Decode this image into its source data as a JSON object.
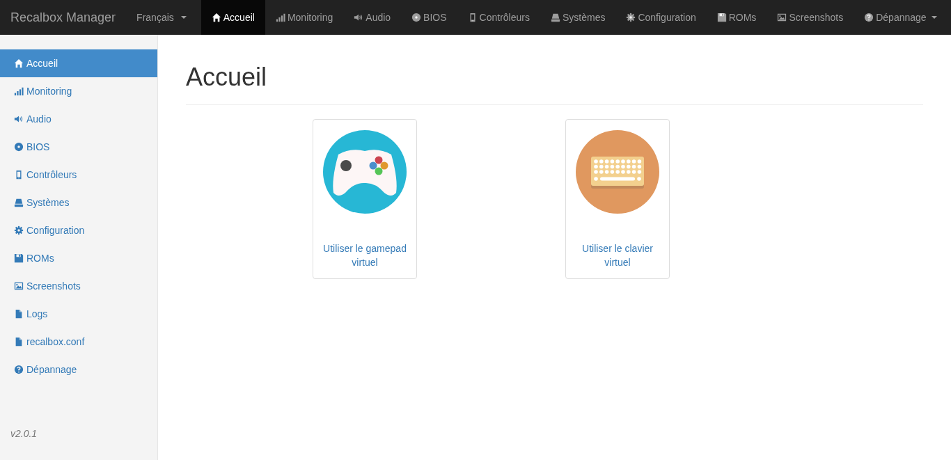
{
  "navbar": {
    "brand": "Recalbox Manager",
    "language": "Français",
    "items": [
      {
        "label": "Accueil",
        "selected": true
      },
      {
        "label": "Monitoring",
        "selected": false
      },
      {
        "label": "Audio",
        "selected": false
      },
      {
        "label": "BIOS",
        "selected": false
      },
      {
        "label": "Contrôleurs",
        "selected": false
      },
      {
        "label": "Systèmes",
        "selected": false
      },
      {
        "label": "Configuration",
        "selected": false
      },
      {
        "label": "ROMs",
        "selected": false
      },
      {
        "label": "Screenshots",
        "selected": false
      },
      {
        "label": "Dépannage",
        "selected": false
      }
    ]
  },
  "sidebar": {
    "items": [
      {
        "label": "Accueil",
        "selected": true
      },
      {
        "label": "Monitoring",
        "selected": false
      },
      {
        "label": "Audio",
        "selected": false
      },
      {
        "label": "BIOS",
        "selected": false
      },
      {
        "label": "Contrôleurs",
        "selected": false
      },
      {
        "label": "Systèmes",
        "selected": false
      },
      {
        "label": "Configuration",
        "selected": false
      },
      {
        "label": "ROMs",
        "selected": false
      },
      {
        "label": "Screenshots",
        "selected": false
      },
      {
        "label": "Logs",
        "selected": false
      },
      {
        "label": "recalbox.conf",
        "selected": false
      },
      {
        "label": "Dépannage",
        "selected": false
      }
    ],
    "version": "v2.0.1"
  },
  "page": {
    "title": "Accueil",
    "cards": [
      {
        "kind": "gamepad",
        "label": "Utiliser le gamepad virtuel"
      },
      {
        "kind": "keyboard",
        "label": "Utiliser le clavier virtuel"
      }
    ]
  }
}
